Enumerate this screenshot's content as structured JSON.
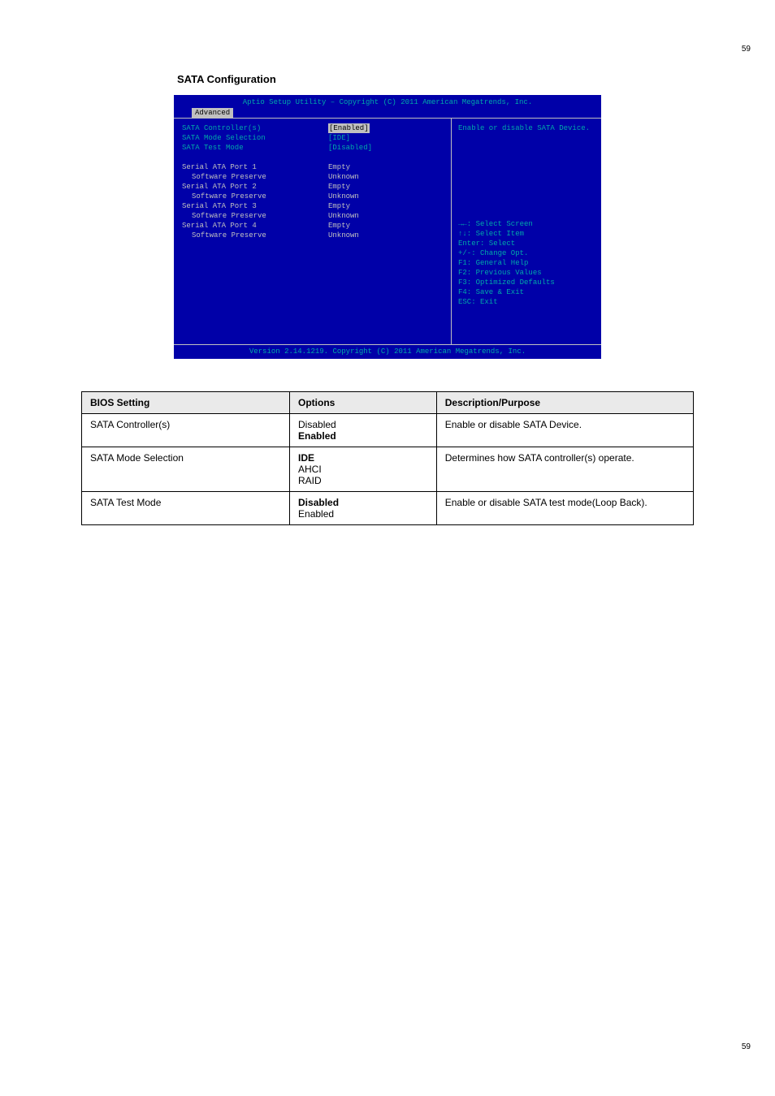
{
  "page_number_top": "59",
  "page_number_bottom": "59",
  "section_heading": "SATA Configuration",
  "bios": {
    "title": "Aptio Setup Utility – Copyright (C) 2011 American Megatrends, Inc.",
    "tab": "Advanced",
    "footer": "Version 2.14.1219. Copyright (C) 2011 American Megatrends, Inc.",
    "help_text": "Enable or disable SATA Device.",
    "settings": [
      {
        "label": "SATA Controller(s)",
        "value": "[Enabled]",
        "editable": true,
        "selected": true
      },
      {
        "label": "SATA Mode Selection",
        "value": "[IDE]",
        "editable": true
      },
      {
        "label": "SATA Test Mode",
        "value": "[Disabled]",
        "editable": true
      },
      {
        "blank": true
      },
      {
        "label": "Serial ATA Port 1",
        "value": "Empty",
        "static": true
      },
      {
        "label": "Software Preserve",
        "value": "Unknown",
        "static": true,
        "indent": true
      },
      {
        "label": "Serial ATA Port 2",
        "value": "Empty",
        "static": true
      },
      {
        "label": "Software Preserve",
        "value": "Unknown",
        "static": true,
        "indent": true
      },
      {
        "label": "Serial ATA Port 3",
        "value": "Empty",
        "static": true
      },
      {
        "label": "Software Preserve",
        "value": "Unknown",
        "static": true,
        "indent": true
      },
      {
        "label": "Serial ATA Port 4",
        "value": "Empty",
        "static": true
      },
      {
        "label": "Software Preserve",
        "value": "Unknown",
        "static": true,
        "indent": true
      }
    ],
    "keys": [
      "→←: Select Screen",
      "↑↓: Select Item",
      "Enter: Select",
      "+/-: Change Opt.",
      "F1: General Help",
      "F2: Previous Values",
      "F3: Optimized Defaults",
      "F4: Save & Exit",
      "ESC: Exit"
    ]
  },
  "table": {
    "headers": [
      "BIOS Setting",
      "Options",
      "Description/Purpose"
    ],
    "rows": [
      {
        "setting": "SATA Controller(s)",
        "options": [
          {
            "text": "Disabled"
          },
          {
            "text": "Enabled",
            "default": true
          }
        ],
        "description": "Enable or disable SATA Device."
      },
      {
        "setting": "SATA Mode Selection",
        "options": [
          {
            "text": "IDE",
            "default": true
          },
          {
            "text": "AHCI"
          },
          {
            "text": "RAID"
          }
        ],
        "description": "Determines how SATA controller(s) operate."
      },
      {
        "setting": "SATA Test Mode",
        "options": [
          {
            "text": "Disabled",
            "default": true
          },
          {
            "text": "Enabled"
          }
        ],
        "description": "Enable or disable SATA test mode(Loop Back)."
      }
    ]
  }
}
